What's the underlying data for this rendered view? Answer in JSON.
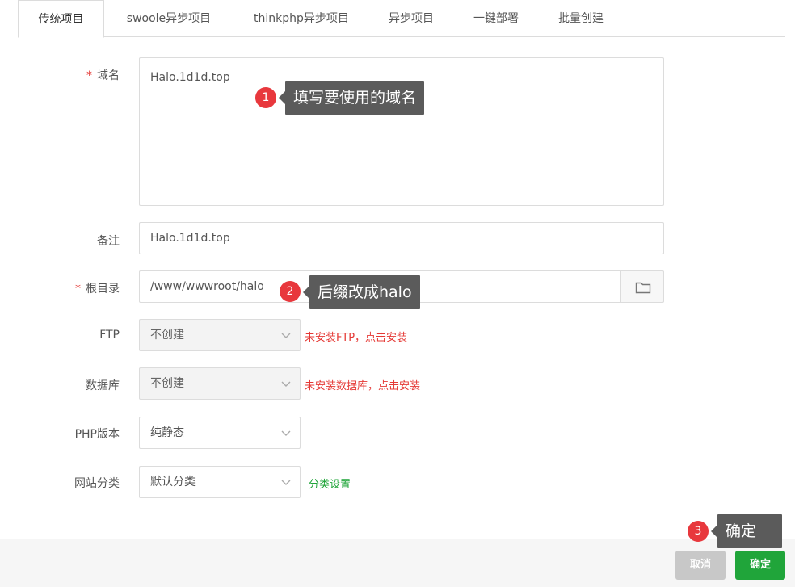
{
  "tabs": [
    {
      "label": "传统项目",
      "active": true
    },
    {
      "label": "swoole异步项目"
    },
    {
      "label": "thinkphp异步项目"
    },
    {
      "label": "异步项目"
    },
    {
      "label": "一键部署"
    },
    {
      "label": "批量创建"
    }
  ],
  "form": {
    "domain": {
      "required_mark": "*",
      "label": "域名",
      "value": "Halo.1d1d.top"
    },
    "note": {
      "label": "备注",
      "value": "Halo.1d1d.top"
    },
    "root": {
      "required_mark": "*",
      "label": "根目录",
      "value": "/www/wwwroot/halo"
    },
    "ftp": {
      "label": "FTP",
      "value": "不创建",
      "warning": "未安装FTP，点击安装"
    },
    "database": {
      "label": "数据库",
      "value": "不创建",
      "warning": "未安装数据库，点击安装"
    },
    "php": {
      "label": "PHP版本",
      "value": "纯静态"
    },
    "category": {
      "label": "网站分类",
      "value": "默认分类",
      "link": "分类设置"
    }
  },
  "annotations": [
    {
      "num": "1",
      "text": "填写要使用的域名"
    },
    {
      "num": "2",
      "text": "后缀改成halo"
    },
    {
      "num": "3",
      "text": "确定"
    }
  ],
  "footer": {
    "cancel_label": "取消",
    "ok_label": "确定"
  },
  "colors": {
    "accent_green": "#20a53a",
    "warning_red": "#e53935",
    "badge_red": "#e8383d",
    "tooltip_gray": "#5b5b5b"
  }
}
